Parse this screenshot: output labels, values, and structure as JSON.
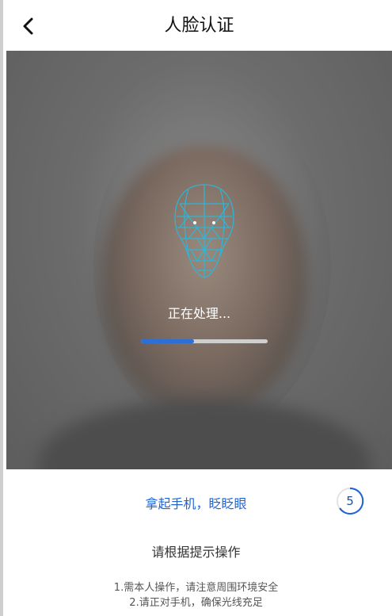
{
  "header": {
    "title": "人脸认证",
    "back_icon": "chevron-left-icon",
    "top_fragment": "…"
  },
  "camera": {
    "status_text": "正在处理...",
    "progress": 0.42,
    "colors": {
      "progress": "#2c6fd6",
      "track": "#cfcfcf",
      "mesh": "#2bb7d8"
    }
  },
  "prompt": {
    "instruction": "拿起手机，眨眨眼",
    "countdown": "5",
    "subtitle": "请根据提示操作",
    "tips": [
      "1.需本人操作，请注意周围环境安全",
      "2.请正对手机，确保光线充足"
    ]
  }
}
